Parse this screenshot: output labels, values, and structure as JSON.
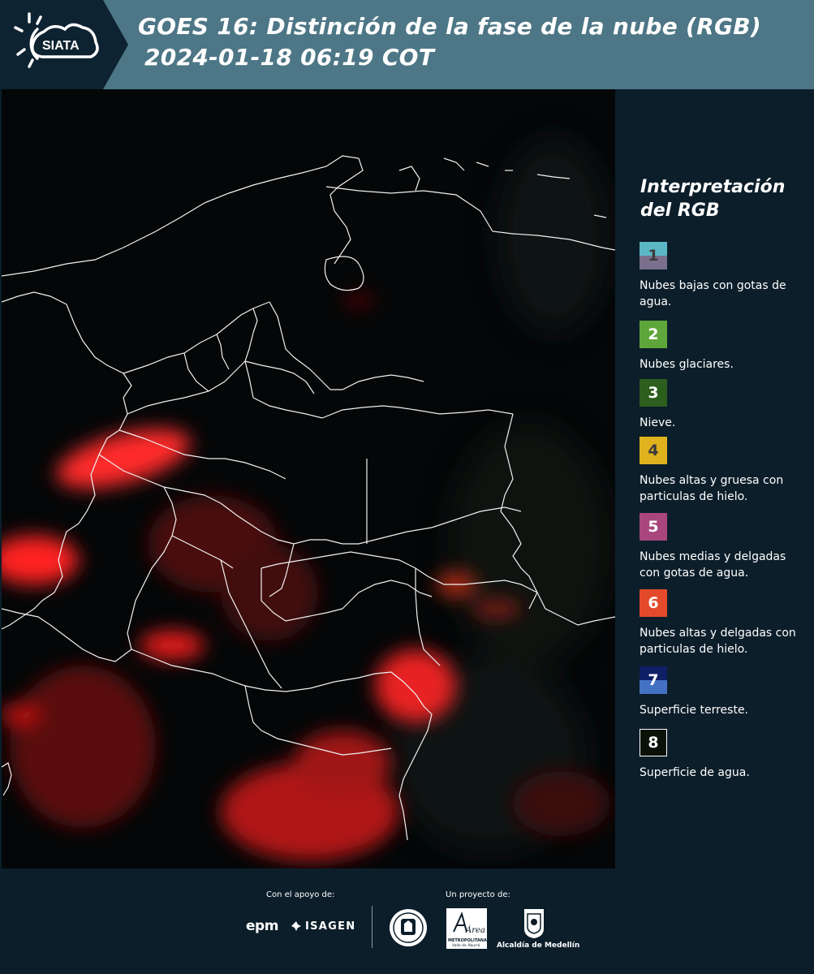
{
  "header": {
    "logo_text": "SIATA",
    "title_line1": "GOES 16: Distinción de la fase de la nube (RGB)",
    "title_line2": "2024-01-18 06:19 COT"
  },
  "legend": {
    "title_line1": "Interpretación",
    "title_line2": "del RGB",
    "items": [
      {
        "number": "1",
        "label": "Nubes bajas con gotas de agua.",
        "color_top": "#5bb7c6",
        "color_bottom": "#7a6f8c"
      },
      {
        "number": "2",
        "label": "Nubes glaciares.",
        "color_top": "#5fa63a",
        "color_bottom": "#5fa63a"
      },
      {
        "number": "3",
        "label": "Nieve.",
        "color_top": "#2c5e1e",
        "color_bottom": "#2c5e1e"
      },
      {
        "number": "4",
        "label": "Nubes altas y gruesa con particulas de hielo.",
        "color_top": "#e0b21e",
        "color_bottom": "#e0b21e"
      },
      {
        "number": "5",
        "label": "Nubes medias y delgadas con gotas de agua.",
        "color_top": "#a9467e",
        "color_bottom": "#a9467e"
      },
      {
        "number": "6",
        "label": "Nubes altas y delgadas con particulas de hielo.",
        "color_top": "#e34a2b",
        "color_bottom": "#e34a2b"
      },
      {
        "number": "7",
        "label": "Superficie terreste.",
        "color_top": "#0f1f66",
        "color_bottom": "#4571c4"
      },
      {
        "number": "8",
        "label": "Superficie de agua.",
        "color_top": "#0a1208",
        "color_bottom": "#0a1208"
      }
    ]
  },
  "footer": {
    "support_label": "Con el apoyo de:",
    "project_label": "Un proyecto de:",
    "sponsor1": "epm",
    "sponsor2": "ISAGEN",
    "partner_area_text": "Área",
    "partner_area_sub1": "METROPOLITANA",
    "partner_area_sub2": "Valle de Aburrá",
    "partner_alcaldia": "Alcaldía de Medellín"
  }
}
